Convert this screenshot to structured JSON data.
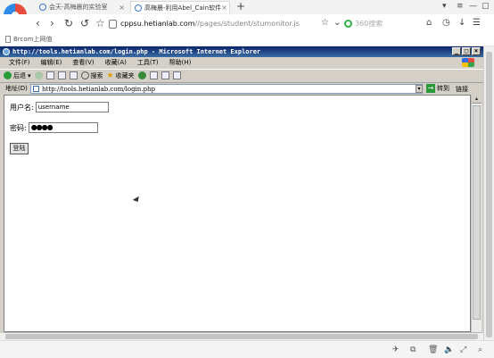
{
  "browser": {
    "tabs": [
      {
        "title": "会天-高梅晨的实验室",
        "active": false
      },
      {
        "title": "高梅晨-利用Abel_Cain软件",
        "active": true
      }
    ],
    "new_tab_label": "+",
    "address": {
      "domain": "cppsu.hetianlab.com",
      "path": "//pages/student/stumonitor.js"
    },
    "search_placeholder": "360搜索",
    "bookmark": "Brcom上网值"
  },
  "ie": {
    "title": "http://tools.hetianlab.com/login.php - Microsoft Internet Explorer",
    "menu": [
      "文件(F)",
      "编辑(E)",
      "查看(V)",
      "收藏(A)",
      "工具(T)",
      "帮助(H)"
    ],
    "toolbar": {
      "back": "后退",
      "search": "搜索",
      "favorites": "收藏夹"
    },
    "address_label": "地址(D)",
    "address_value": "http://tools.hetianlab.com/login.php",
    "go_label": "转到",
    "links_label": "链接"
  },
  "form": {
    "username_label": "用户名:",
    "username_value": "username",
    "password_label": "密码:",
    "password_value": "●●●●",
    "submit_label": "登陆"
  },
  "icons": {
    "logo": "360-browser-logo",
    "ie": "internet-explorer-icon",
    "windows": "windows-xp-logo"
  }
}
